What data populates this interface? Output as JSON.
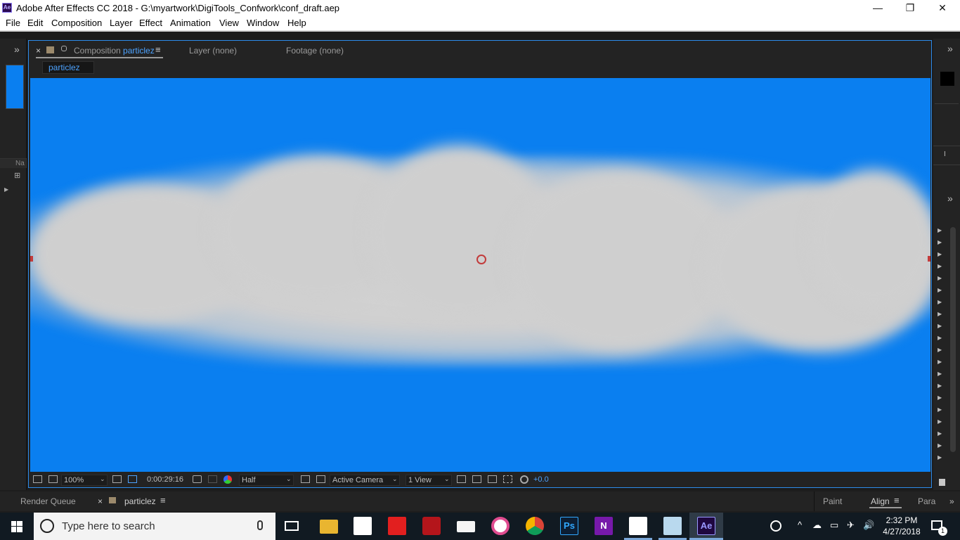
{
  "window": {
    "title": "Adobe After Effects CC 2018 - G:\\myartwork\\DigiTools_Confwork\\conf_draft.aep",
    "logo": "Ae",
    "controls": [
      "minimize-icon",
      "maximize-icon",
      "close-icon"
    ],
    "minimize_glyph": "—",
    "maximize_glyph": "❐",
    "close_glyph": "✕"
  },
  "menu": [
    "File",
    "Edit",
    "Composition",
    "Layer",
    "Effect",
    "Animation",
    "View",
    "Window",
    "Help"
  ],
  "comp_panel": {
    "close_glyph": "×",
    "tab_prefix": "Composition",
    "comp_name": "particlez",
    "menu_glyph": "≡",
    "layer_tab": "Layer (none)",
    "footage_tab": "Footage (none)",
    "breadcrumb": "particlez"
  },
  "left_panel": {
    "expand_glyph": "»",
    "col_label": "Na",
    "flow_glyph": "⊞",
    "triangle_glyph": "▶",
    "swatch_color": "#0a7ff0"
  },
  "right_panel": {
    "expand_glyph": "»",
    "expand_glyph_2": "»",
    "cursor_glyph": "I",
    "triangle_glyph": "▶",
    "triangle_count": 20
  },
  "viewer_toolbar": {
    "zoom": "100%",
    "timecode": "0:00:29:16",
    "resolution": "Half",
    "camera": "Active Camera",
    "views": "1 View",
    "exposure": "+0.0",
    "chevron": "⌄"
  },
  "bottom_tabs": {
    "render_queue": "Render Queue",
    "close_glyph": "×",
    "timeline": "particlez",
    "menu_glyph": "≡",
    "paint": "Paint",
    "align": "Align",
    "para": "Para",
    "more_glyph": "»"
  },
  "taskbar": {
    "search_placeholder": "Type here to search",
    "time": "2:32 PM",
    "date": "4/27/2018",
    "notification_count": "1",
    "ae_label": "Ae",
    "ps_label": "Ps",
    "on_label": "N",
    "tray_glyphs": [
      "^",
      "☁",
      "▭",
      "✈",
      "🔊"
    ],
    "apps": [
      "task-view-icon",
      "file-explorer-icon",
      "store-icon",
      "app-red-icon",
      "mcafee-icon",
      "mail-icon",
      "itunes-icon",
      "chrome-icon",
      "photoshop-icon",
      "onenote-icon",
      "sticky-notes-icon",
      "notepad-icon",
      "after-effects-icon"
    ]
  },
  "colors": {
    "accent": "#2d8ceb",
    "link_blue": "#4da3ff",
    "sky": "#0a7ff0",
    "cloud": "#d2d2d2"
  }
}
